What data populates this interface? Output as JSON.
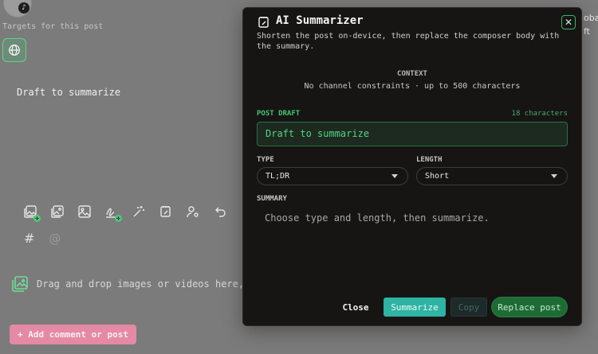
{
  "background": {
    "targets_label": "Targets for this post",
    "draft_text": "Draft to summarize",
    "drop_text": "Drag and drop images or videos here, or",
    "add_button_label": "+ Add comment or post",
    "hash_symbol": "#",
    "at_symbol": "@",
    "right_edge_text_top": "obal",
    "right_edge_text_bottom": "ft",
    "avatar_badge_icon": "tiktok-icon"
  },
  "modal": {
    "title": "AI Summarizer",
    "subtitle": "Shorten the post on-device, then replace the composer body with the summary.",
    "context": {
      "label": "CONTEXT",
      "text": "No channel constraints · up to 500 characters"
    },
    "post_draft": {
      "label": "POST DRAFT",
      "count": "18 characters",
      "value": "Draft to summarize"
    },
    "type": {
      "label": "TYPE",
      "selected": "TL;DR"
    },
    "length": {
      "label": "LENGTH",
      "selected": "Short"
    },
    "summary": {
      "label": "SUMMARY",
      "placeholder": "Choose type and length, then summarize."
    },
    "buttons": {
      "close": "Close",
      "summarize": "Summarize",
      "copy": "Copy",
      "replace": "Replace post"
    },
    "close_icon": "close-icon"
  },
  "colors": {
    "accent_green": "#46c470",
    "teal": "#2fb3a3",
    "pink_button": "#e48aa4",
    "modal_bg": "#161514"
  }
}
